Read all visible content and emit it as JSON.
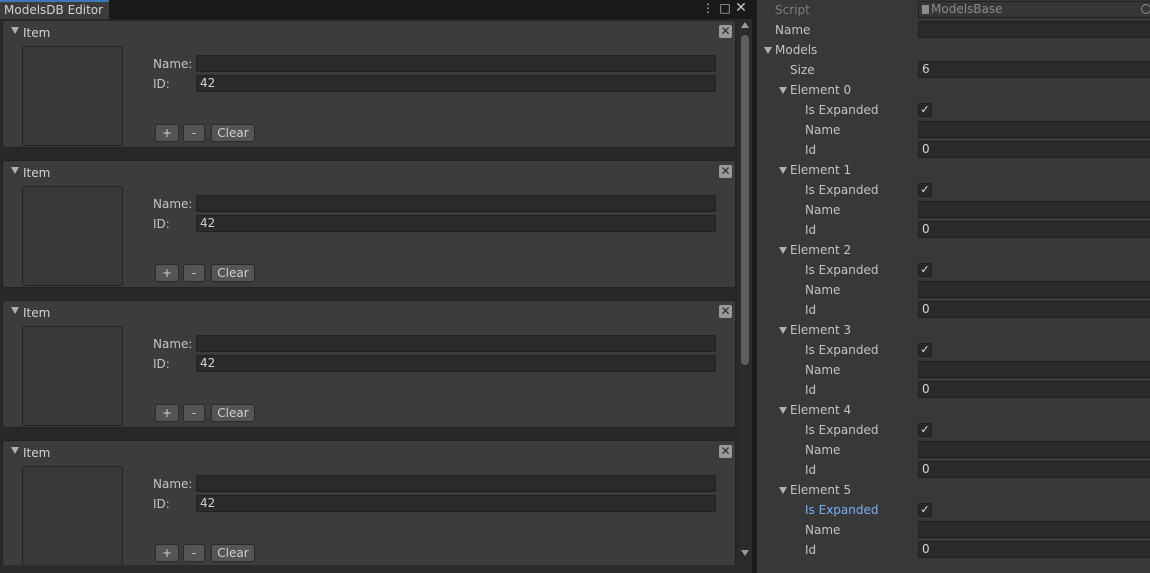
{
  "window": {
    "tab_title": "ModelsDB Editor",
    "menu_icon": "kebab-menu-icon",
    "maximize_icon": "maximize-icon",
    "close_icon": "close-icon"
  },
  "items": [
    {
      "title": "Item",
      "name_label": "Name:",
      "name_value": "",
      "id_label": "ID:",
      "id_value": "42",
      "plus": "+",
      "minus": "-",
      "clear": "Clear"
    },
    {
      "title": "Item",
      "name_label": "Name:",
      "name_value": "",
      "id_label": "ID:",
      "id_value": "42",
      "plus": "+",
      "minus": "-",
      "clear": "Clear"
    },
    {
      "title": "Item",
      "name_label": "Name:",
      "name_value": "",
      "id_label": "ID:",
      "id_value": "42",
      "plus": "+",
      "minus": "-",
      "clear": "Clear"
    },
    {
      "title": "Item",
      "name_label": "Name:",
      "name_value": "",
      "id_label": "ID:",
      "id_value": "42",
      "plus": "+",
      "minus": "-",
      "clear": "Clear"
    }
  ],
  "inspector": {
    "script_label": "Script",
    "script_value": "ModelsBase",
    "name_label": "Name",
    "name_value": "",
    "models_label": "Models",
    "size_label": "Size",
    "size_value": "6",
    "is_expanded_label": "Is Expanded",
    "element_name_label": "Name",
    "element_id_label": "Id",
    "elements": [
      {
        "title": "Element 0",
        "is_expanded": true,
        "name": "",
        "id": "0"
      },
      {
        "title": "Element 1",
        "is_expanded": true,
        "name": "",
        "id": "0"
      },
      {
        "title": "Element 2",
        "is_expanded": true,
        "name": "",
        "id": "0"
      },
      {
        "title": "Element 3",
        "is_expanded": true,
        "name": "",
        "id": "0"
      },
      {
        "title": "Element 4",
        "is_expanded": true,
        "name": "",
        "id": "0"
      },
      {
        "title": "Element 5",
        "is_expanded": true,
        "name": "",
        "id": "0"
      }
    ],
    "check_glyph": "✓"
  },
  "colors": {
    "panel_bg": "#383838",
    "window_bg": "#282828",
    "tab_accent": "#3a79bb",
    "highlight_label": "#7aaefc"
  }
}
